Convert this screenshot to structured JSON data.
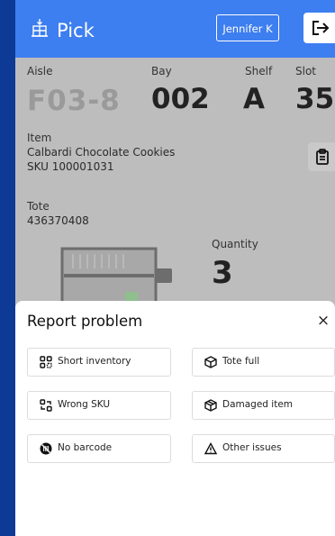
{
  "header": {
    "title": "Pick",
    "logo_icon": "package-hand-icon",
    "user_label": "Jennifer K",
    "logout_icon": "logout-icon"
  },
  "location": {
    "aisle_label": "Aisle",
    "aisle_value": "F03-8",
    "bay_label": "Bay",
    "bay_value": "002",
    "shelf_label": "Shelf",
    "shelf_value": "A",
    "slot_label": "Slot",
    "slot_value": "35"
  },
  "item": {
    "label": "Item",
    "name": "Calbardi Chocolate Cookies",
    "sku": "SKU 100001031",
    "clipboard_icon": "clipboard-icon"
  },
  "tote": {
    "label": "Tote",
    "value": "436370408"
  },
  "quantity": {
    "label": "Quantity",
    "value": "3"
  },
  "report_sheet": {
    "title": "Report problem",
    "close_glyph": "×",
    "options": [
      {
        "label": "Short inventory",
        "icon": "short-inventory-icon"
      },
      {
        "label": "Tote full",
        "icon": "box-icon"
      },
      {
        "label": "Wrong SKU",
        "icon": "swap-icon"
      },
      {
        "label": "Damaged item",
        "icon": "damaged-box-icon"
      },
      {
        "label": "No barcode",
        "icon": "no-barcode-icon"
      },
      {
        "label": "Other issues",
        "icon": "warning-triangle-icon"
      }
    ]
  },
  "colors": {
    "background": "#0c3a95",
    "header": "#3d7ef0",
    "overlay_dim": "#bdbdbd",
    "sheet": "#ffffff"
  }
}
